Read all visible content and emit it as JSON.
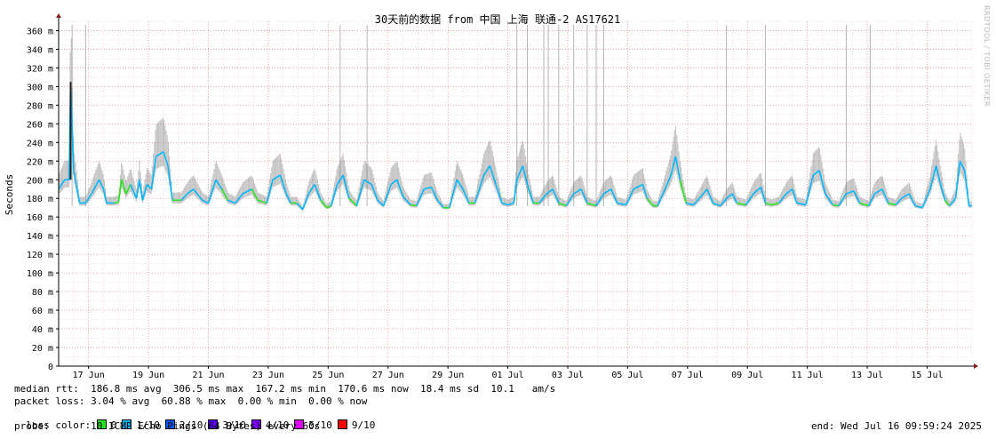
{
  "chart_data": {
    "type": "line",
    "title": "30天前的数据 from 中国 上海 联通-2 AS17621",
    "xlabel": "",
    "ylabel": "Seconds",
    "ylim": [
      0,
      370
    ],
    "grid": true,
    "y_ticks": [
      "0",
      "20 m",
      "40 m",
      "60 m",
      "80 m",
      "100 m",
      "120 m",
      "140 m",
      "160 m",
      "180 m",
      "200 m",
      "220 m",
      "240 m",
      "260 m",
      "280 m",
      "300 m",
      "320 m",
      "340 m",
      "360 m"
    ],
    "x_ticks": [
      "17 Jun",
      "19 Jun",
      "21 Jun",
      "23 Jun",
      "25 Jun",
      "27 Jun",
      "29 Jun",
      "01 Jul",
      "03 Jul",
      "05 Jul",
      "07 Jul",
      "09 Jul",
      "11 Jul",
      "13 Jul",
      "15 Jul"
    ],
    "x_range_days": [
      0,
      30.5
    ],
    "series": [
      {
        "name": "median rtt",
        "unit": "ms",
        "values": [
          [
            0.0,
            190
          ],
          [
            0.2,
            200
          ],
          [
            0.35,
            200
          ],
          [
            0.4,
            305
          ],
          [
            0.5,
            210
          ],
          [
            0.7,
            175
          ],
          [
            0.9,
            175
          ],
          [
            1.1,
            185
          ],
          [
            1.35,
            200
          ],
          [
            1.5,
            190
          ],
          [
            1.6,
            175
          ],
          [
            1.85,
            175
          ],
          [
            2.0,
            176
          ],
          [
            2.1,
            200
          ],
          [
            2.25,
            185
          ],
          [
            2.4,
            195
          ],
          [
            2.6,
            180
          ],
          [
            2.7,
            200
          ],
          [
            2.8,
            178
          ],
          [
            2.95,
            195
          ],
          [
            3.1,
            190
          ],
          [
            3.25,
            225
          ],
          [
            3.5,
            230
          ],
          [
            3.65,
            215
          ],
          [
            3.8,
            178
          ],
          [
            4.1,
            178
          ],
          [
            4.3,
            185
          ],
          [
            4.5,
            190
          ],
          [
            4.8,
            178
          ],
          [
            5.0,
            175
          ],
          [
            5.25,
            200
          ],
          [
            5.45,
            190
          ],
          [
            5.65,
            178
          ],
          [
            5.9,
            175
          ],
          [
            6.15,
            185
          ],
          [
            6.45,
            190
          ],
          [
            6.65,
            178
          ],
          [
            6.95,
            175
          ],
          [
            7.15,
            200
          ],
          [
            7.4,
            205
          ],
          [
            7.6,
            185
          ],
          [
            7.75,
            175
          ],
          [
            7.95,
            175
          ],
          [
            8.15,
            168
          ],
          [
            8.35,
            185
          ],
          [
            8.55,
            195
          ],
          [
            8.75,
            178
          ],
          [
            8.95,
            170
          ],
          [
            9.1,
            172
          ],
          [
            9.3,
            195
          ],
          [
            9.5,
            205
          ],
          [
            9.7,
            180
          ],
          [
            9.95,
            172
          ],
          [
            10.2,
            200
          ],
          [
            10.45,
            195
          ],
          [
            10.65,
            178
          ],
          [
            10.85,
            172
          ],
          [
            11.1,
            195
          ],
          [
            11.3,
            200
          ],
          [
            11.5,
            182
          ],
          [
            11.75,
            173
          ],
          [
            11.95,
            172
          ],
          [
            12.2,
            190
          ],
          [
            12.45,
            192
          ],
          [
            12.65,
            178
          ],
          [
            12.85,
            170
          ],
          [
            13.05,
            170
          ],
          [
            13.3,
            200
          ],
          [
            13.5,
            190
          ],
          [
            13.7,
            175
          ],
          [
            13.9,
            175
          ],
          [
            14.2,
            205
          ],
          [
            14.4,
            215
          ],
          [
            14.6,
            195
          ],
          [
            14.8,
            175
          ],
          [
            15.0,
            173
          ],
          [
            15.2,
            175
          ],
          [
            15.3,
            200
          ],
          [
            15.5,
            215
          ],
          [
            15.65,
            195
          ],
          [
            15.85,
            175
          ],
          [
            16.05,
            175
          ],
          [
            16.3,
            185
          ],
          [
            16.5,
            190
          ],
          [
            16.7,
            175
          ],
          [
            16.95,
            172
          ],
          [
            17.2,
            185
          ],
          [
            17.45,
            190
          ],
          [
            17.65,
            175
          ],
          [
            17.95,
            172
          ],
          [
            18.2,
            185
          ],
          [
            18.45,
            190
          ],
          [
            18.65,
            175
          ],
          [
            18.95,
            173
          ],
          [
            19.2,
            190
          ],
          [
            19.5,
            195
          ],
          [
            19.65,
            180
          ],
          [
            19.85,
            172
          ],
          [
            20.0,
            172
          ],
          [
            20.25,
            190
          ],
          [
            20.45,
            205
          ],
          [
            20.6,
            225
          ],
          [
            20.75,
            200
          ],
          [
            20.95,
            175
          ],
          [
            21.2,
            173
          ],
          [
            21.45,
            182
          ],
          [
            21.65,
            190
          ],
          [
            21.85,
            175
          ],
          [
            22.1,
            172
          ],
          [
            22.3,
            180
          ],
          [
            22.5,
            185
          ],
          [
            22.65,
            175
          ],
          [
            22.95,
            173
          ],
          [
            23.2,
            185
          ],
          [
            23.45,
            192
          ],
          [
            23.6,
            175
          ],
          [
            23.8,
            173
          ],
          [
            24.05,
            175
          ],
          [
            24.3,
            185
          ],
          [
            24.5,
            190
          ],
          [
            24.65,
            175
          ],
          [
            24.95,
            173
          ],
          [
            25.2,
            205
          ],
          [
            25.4,
            210
          ],
          [
            25.6,
            185
          ],
          [
            25.85,
            173
          ],
          [
            26.05,
            172
          ],
          [
            26.3,
            185
          ],
          [
            26.55,
            188
          ],
          [
            26.75,
            175
          ],
          [
            27.05,
            172
          ],
          [
            27.25,
            185
          ],
          [
            27.5,
            190
          ],
          [
            27.7,
            175
          ],
          [
            27.95,
            173
          ],
          [
            28.15,
            180
          ],
          [
            28.4,
            185
          ],
          [
            28.6,
            172
          ],
          [
            28.85,
            170
          ],
          [
            29.1,
            190
          ],
          [
            29.3,
            215
          ],
          [
            29.45,
            195
          ],
          [
            29.6,
            178
          ],
          [
            29.75,
            172
          ],
          [
            29.95,
            180
          ],
          [
            30.1,
            220
          ],
          [
            30.25,
            210
          ],
          [
            30.4,
            172
          ],
          [
            30.5,
            172
          ]
        ]
      }
    ],
    "loss_points_days": [
      1.9,
      2.3,
      3.9,
      5.5,
      6.7,
      7.9,
      8.9,
      9.9,
      11.8,
      12.9,
      13.9,
      15.9,
      16.9,
      17.8,
      19.8,
      20.9,
      22.9,
      23.8,
      25.9,
      26.8,
      27.8,
      29.7
    ]
  },
  "legend": {
    "median_rtt": "median rtt:  186.8 ms avg  306.5 ms max  167.2 ms min  170.6 ms now  18.4 ms sd  10.1   am/s",
    "packet_loss": "packet loss: 3.04 % avg  60.88 % max  0.00 % min  0.00 % now",
    "loss_color_label": "loss color: ",
    "loss_colors": [
      {
        "label": "0",
        "color": "#26e51f"
      },
      {
        "label": "1/10",
        "color": "#00b8ff"
      },
      {
        "label": "2/10",
        "color": "#0059ff"
      },
      {
        "label": "3/10",
        "color": "#5e00ff"
      },
      {
        "label": "4/10",
        "color": "#7e00ff"
      },
      {
        "label": "5/10",
        "color": "#dd00ff"
      },
      {
        "label": "9/10",
        "color": "#ff0000"
      }
    ],
    "probe": "probe:       10 ICMP Echo Pings (64 Bytes) every 60s",
    "end": "end: Wed Jul 16 09:59:24 2025"
  },
  "watermark": "RRDTOOL / TOBI OETIKER"
}
